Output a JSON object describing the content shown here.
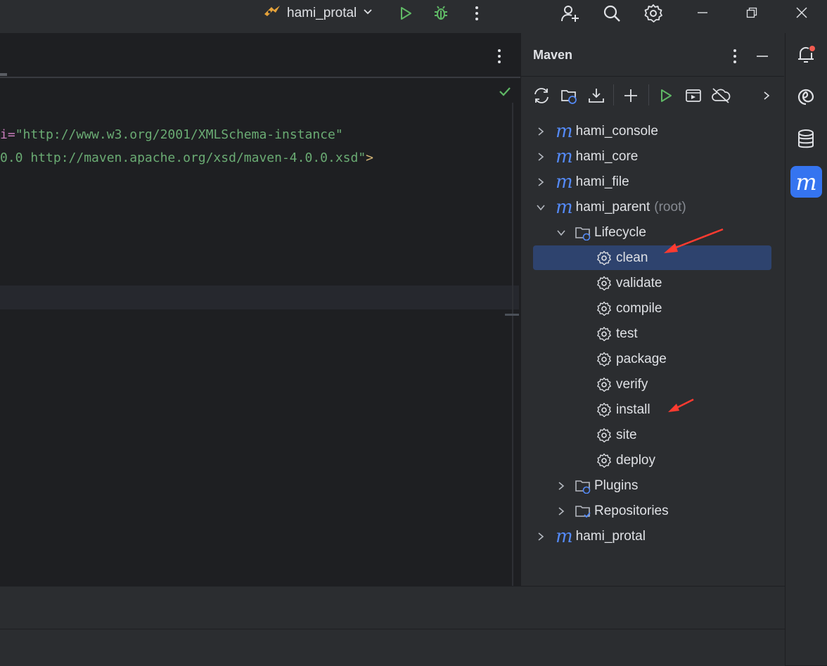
{
  "titlebar": {
    "run_config": "hami_protal"
  },
  "editor": {
    "line1": {
      "attr": "i=",
      "value": "\"http://www.w3.org/2001/XMLSchema-instance\""
    },
    "line2": {
      "value": "0.0 http://maven.apache.org/xsd/maven-4.0.0.xsd\"",
      "close": ">"
    }
  },
  "maven": {
    "title": "Maven",
    "tree": [
      {
        "label": "hami_console",
        "kind": "module",
        "expanded": false
      },
      {
        "label": "hami_core",
        "kind": "module",
        "expanded": false
      },
      {
        "label": "hami_file",
        "kind": "module",
        "expanded": false
      },
      {
        "label": "hami_parent",
        "suffix": "(root)",
        "kind": "module",
        "expanded": true
      },
      {
        "label": "Lifecycle",
        "kind": "folder",
        "expanded": true
      },
      {
        "label": "clean",
        "kind": "goal",
        "selected": true
      },
      {
        "label": "validate",
        "kind": "goal"
      },
      {
        "label": "compile",
        "kind": "goal"
      },
      {
        "label": "test",
        "kind": "goal"
      },
      {
        "label": "package",
        "kind": "goal"
      },
      {
        "label": "verify",
        "kind": "goal"
      },
      {
        "label": "install",
        "kind": "goal"
      },
      {
        "label": "site",
        "kind": "goal"
      },
      {
        "label": "deploy",
        "kind": "goal"
      },
      {
        "label": "Plugins",
        "kind": "folder",
        "expanded": false
      },
      {
        "label": "Repositories",
        "kind": "folder",
        "expanded": false
      },
      {
        "label": "hami_protal",
        "kind": "module",
        "expanded": false
      }
    ]
  },
  "colors": {
    "accent": "#3574f0",
    "selection": "#2e436e",
    "run_green": "#5fb865",
    "annotation_arrow": "#ff3b30"
  },
  "icons": [
    "run-config-icon",
    "chevron-down-icon",
    "run-icon",
    "debug-icon",
    "more-icon",
    "add-user-icon",
    "search-icon",
    "settings-icon",
    "minimize-icon",
    "restore-icon",
    "close-icon",
    "check-icon",
    "reload-icon",
    "generate-sources-icon",
    "download-icon",
    "add-icon",
    "run-maven-icon",
    "execute-goal-icon",
    "offline-icon",
    "expand-icon",
    "notifications-icon",
    "ai-assistant-icon",
    "database-icon",
    "maven-tool-icon"
  ]
}
